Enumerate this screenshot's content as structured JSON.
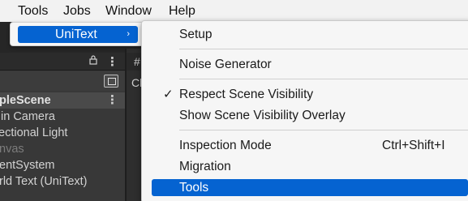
{
  "menubar": {
    "items": [
      "Tools",
      "Jobs",
      "Window",
      "Help"
    ]
  },
  "hierarchy": {
    "scene_row": "pleScene",
    "rows": [
      {
        "label": "in Camera",
        "dim": false
      },
      {
        "label": "ectional Light",
        "dim": false
      },
      {
        "label": "nvas",
        "dim": true
      },
      {
        "label": "entSystem",
        "dim": false
      },
      {
        "label": "rld Text (UniText)",
        "dim": false
      }
    ],
    "menu_glyph": "⋮"
  },
  "right_panel": {
    "tab_glyph": "#",
    "label": "Cl"
  },
  "submenu": {
    "label": "UniText",
    "arrow": "›"
  },
  "dropdown": {
    "setup": "Setup",
    "noise_generator": "Noise Generator",
    "respect_scene_visibility": "Respect Scene Visibility",
    "respect_check": "✓",
    "show_scene_visibility_overlay": "Show Scene Visibility Overlay",
    "inspection_mode": "Inspection Mode",
    "inspection_shortcut": "Ctrl+Shift+I",
    "migration": "Migration",
    "tools": "Tools"
  },
  "colors": {
    "accent": "#0563d1",
    "menu_bg": "#f6f6f6",
    "editor_bg": "#383838"
  }
}
